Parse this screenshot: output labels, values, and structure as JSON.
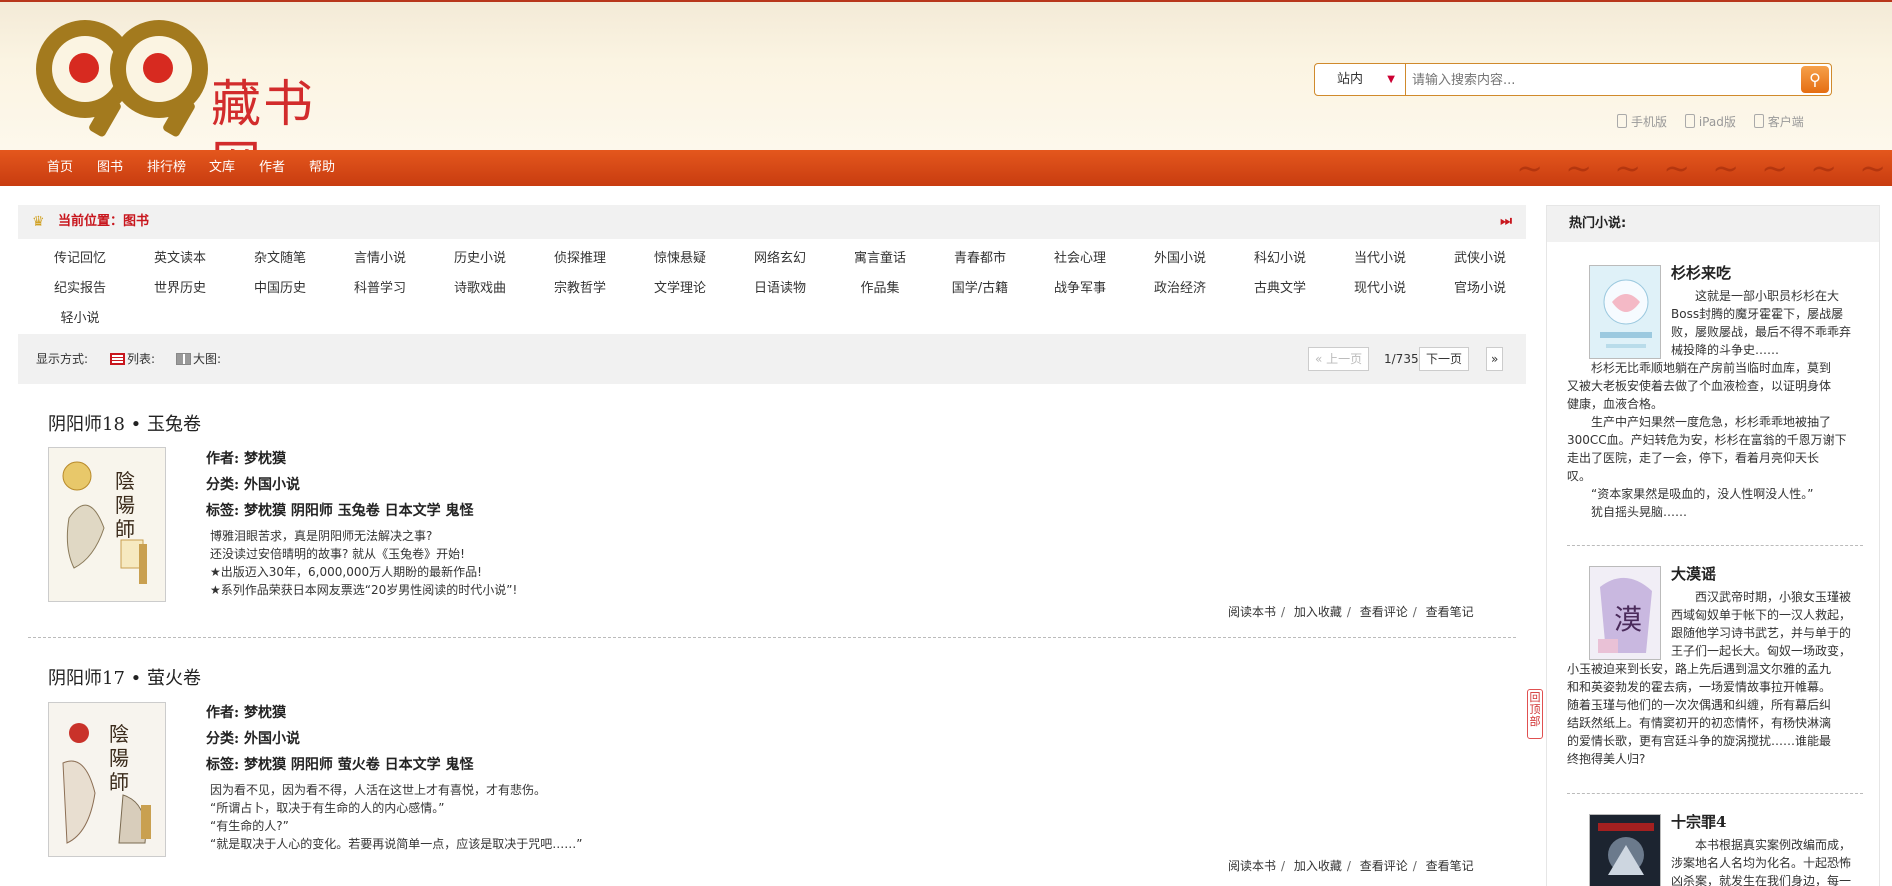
{
  "site": {
    "logo_text": "藏书网"
  },
  "search": {
    "scope": "站内",
    "placeholder": "请输入搜索内容..."
  },
  "client_links": [
    "手机版",
    "iPad版",
    "客户端"
  ],
  "nav": {
    "items": [
      "首页",
      "图书",
      "排行榜",
      "文库",
      "作者",
      "帮助"
    ]
  },
  "breadcrumb": {
    "label": "当前位置：",
    "current": "图书"
  },
  "categories": [
    "传记回忆",
    "英文读本",
    "杂文随笔",
    "言情小说",
    "历史小说",
    "侦探推理",
    "惊悚悬疑",
    "网络玄幻",
    "寓言童话",
    "青春都市",
    "社会心理",
    "外国小说",
    "科幻小说",
    "当代小说",
    "武侠小说",
    "纪实报告",
    "世界历史",
    "中国历史",
    "科普学习",
    "诗歌戏曲",
    "宗教哲学",
    "文学理论",
    "日语读物",
    "作品集",
    "国学/古籍",
    "战争军事",
    "政治经济",
    "古典文学",
    "现代小说",
    "官场小说",
    "轻小说"
  ],
  "view": {
    "label": "显示方式:",
    "list": "列表:",
    "grid": "大图:"
  },
  "pager": {
    "prev": "上一页",
    "page": "1/735",
    "next": "下一页"
  },
  "books": [
    {
      "title": "阴阳师18 • 玉兔卷",
      "author": "作者: 梦枕獏",
      "category": "分类: 外国小说",
      "tags": "标签: 梦枕獏 阴阳师 玉兔卷 日本文学 鬼怪",
      "desc": [
        "博雅泪眼苦求，真是阴阳师无法解决之事?",
        "还没读过安倍晴明的故事? 就从《玉兔卷》开始!",
        "★出版迈入30年，6,000,000万人期盼的最新作品!",
        "★系列作品荣获日本网友票选“20岁男性阅读的时代小说”!"
      ],
      "actions": [
        "阅读本书",
        "加入收藏",
        "查看评论",
        "查看笔记"
      ]
    },
    {
      "title": "阴阳师17 • 萤火卷",
      "author": "作者: 梦枕獏",
      "category": "分类: 外国小说",
      "tags": "标签: 梦枕獏 阴阳师 萤火卷 日本文学 鬼怪",
      "desc": [
        "因为看不见，因为看不得，人活在这世上才有喜悦，才有悲伤。",
        "“所谓占卜，取决于有生命的人的内心感情。”",
        "“有生命的人?”",
        "“就是取决于人心的变化。若要再说简单一点，应该是取决于咒吧……”"
      ],
      "actions": [
        "阅读本书",
        "加入收藏",
        "查看评论",
        "查看笔记"
      ]
    }
  ],
  "back_to_top": "回顶部",
  "sidebar": {
    "title": "热门小说:",
    "items": [
      {
        "title": "杉杉来吃",
        "float_lines": [
          "这就是一部小职员杉杉在大",
          "Boss封腾的魔牙霍霍下，屡战屡",
          "败，屡败屡战，最后不得不乖乖弃",
          "械投降的斗争史……"
        ],
        "lines": [
          "杉杉无比乖顺地躺在产房前当临时血库，莫到",
          "又被大老板安使着去做了个血液检查，以证明身体",
          "健康，血液合格。",
          "生产中产妇果然一度危急，杉杉乖乖地被抽了",
          "300CC血。产妇转危为安，杉杉在富翁的千恩万谢下",
          "走出了医院，走了一会，停下，看着月亮仰天长",
          "叹。",
          "“资本家果然是吸血的，没人性啊没人性。”",
          "犹自摇头晃脑……"
        ]
      },
      {
        "title": "大漠谣",
        "float_lines": [
          "西汉武帝时期，小狼女玉瑾被",
          "西域匈奴单于帐下的一汉人救起，",
          "跟随他学习诗书武艺，并与单于的",
          "王子们一起长大。匈奴一场政变，"
        ],
        "lines": [
          "小玉被迫来到长安，路上先后遇到温文尔雅的孟九",
          "和和英姿勃发的霍去病，一场爱情故事拉开帷幕。",
          "随着玉瑾与他们的一次次偶遇和纠缠，所有幕后纠",
          "结跃然纸上。有情窦初开的初恋情怀，有杨快淋漓",
          "的爱情长歌，更有宫廷斗争的旋涡搅扰……谁能最",
          "终抱得美人归?"
        ]
      },
      {
        "title": "十宗罪4",
        "float_lines": [
          "本书根据真实案例改编而成，",
          "涉案地名人名均为化名。十起恐怖",
          "凶杀案，就发生在我们身边，每一"
        ],
        "lines": []
      }
    ]
  },
  "colors": {
    "brand_red": "#c8161d",
    "nav_orange": "#d94a17",
    "logo_gold": "#a37a1e"
  }
}
